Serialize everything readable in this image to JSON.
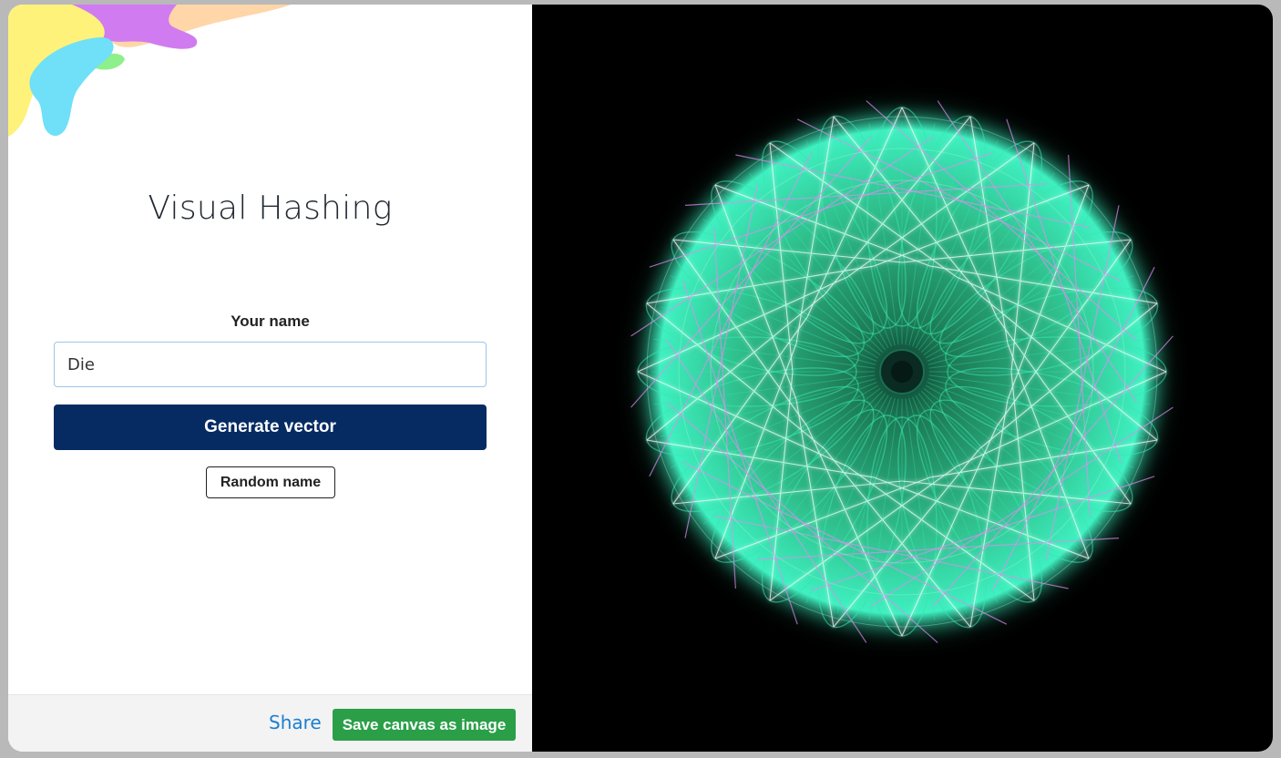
{
  "app": {
    "title": "Visual Hashing"
  },
  "form": {
    "name_label": "Your name",
    "name_value": "Die",
    "generate_label": "Generate vector",
    "random_label": "Random name"
  },
  "footer": {
    "share_label": "Share",
    "save_label": "Save canvas as image"
  },
  "colors": {
    "primary_button": "#062b63",
    "save_button": "#2a9f48",
    "share_link": "#1a7fd1",
    "canvas_background": "#000000",
    "pattern_main": "#38e6b0",
    "pattern_accent": "#e08cf0",
    "blob_yellow": "#fff27a",
    "blob_cyan": "#6fe0f7",
    "blob_purple": "#d07cf0",
    "blob_peach": "#ffd6a8",
    "blob_green": "#8ef08a"
  },
  "icons": {
    "decoration": "abstract-color-blobs"
  }
}
